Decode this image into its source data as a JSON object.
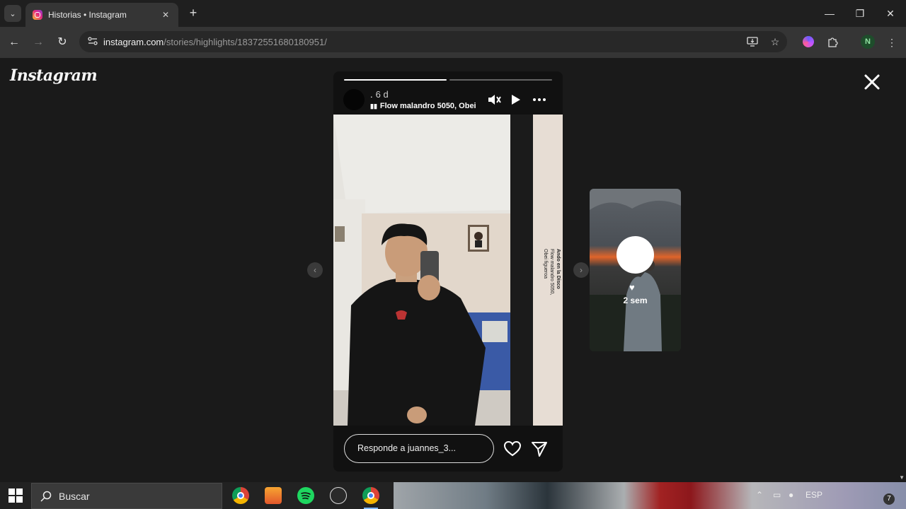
{
  "browser": {
    "tab_title": "Historias • Instagram",
    "tab_close": "✕",
    "new_tab": "+",
    "url_host": "instagram.com",
    "url_path": "/stories/highlights/18372551680180951/",
    "profile_initial": "N",
    "window": {
      "minimize": "—",
      "restore": "❐",
      "close": "✕"
    },
    "nav": {
      "back": "←",
      "forward": "→",
      "reload": "↻"
    }
  },
  "instagram": {
    "logo": "Instagram",
    "story": {
      "username": ".",
      "time": "6 d",
      "music": "Flow malandro 5050, Obei",
      "progress": [
        1.0,
        0.0
      ],
      "caption_lines": [
        "Ando en la Disco",
        "Flow malandro 5050,",
        "Obei figueroa"
      ],
      "reply_placeholder": "Responde a juannes_3..."
    },
    "next_story": {
      "time": "2 sem"
    },
    "nav": {
      "prev": "‹",
      "next": "›"
    }
  },
  "taskbar": {
    "search_label": "Buscar",
    "language": "ESP",
    "notification_count": "7"
  }
}
